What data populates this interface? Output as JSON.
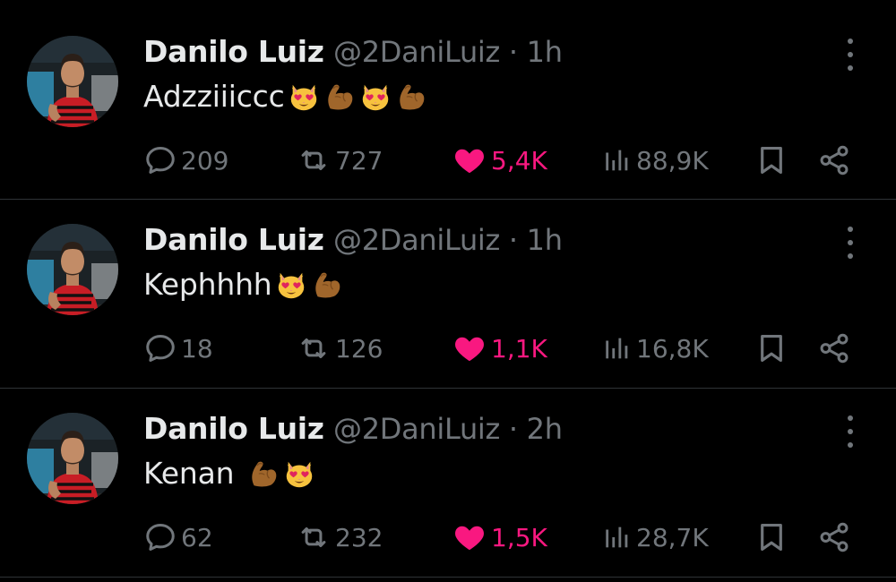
{
  "feed": {
    "tweets": [
      {
        "name": "Danilo Luiz",
        "handle": "@2DaniLuiz",
        "time": "· 1h",
        "text": "Adzziiiccc",
        "emojis": [
          "heart-eyes-cat-icon",
          "flexed-biceps-icon",
          "heart-eyes-cat-icon",
          "flexed-biceps-icon"
        ],
        "replies": "209",
        "reposts": "727",
        "likes": "5,4K",
        "views": "88,9K",
        "liked": true
      },
      {
        "name": "Danilo Luiz",
        "handle": "@2DaniLuiz",
        "time": "· 1h",
        "text": "Kephhhh",
        "emojis": [
          "heart-eyes-cat-icon",
          "flexed-biceps-icon"
        ],
        "replies": "18",
        "reposts": "126",
        "likes": "1,1K",
        "views": "16,8K",
        "liked": true
      },
      {
        "name": "Danilo Luiz",
        "handle": "@2DaniLuiz",
        "time": "· 2h",
        "text": "Kenan",
        "emojis": [
          "flexed-biceps-icon",
          "heart-eyes-cat-icon"
        ],
        "replies": "62",
        "reposts": "232",
        "likes": "1,5K",
        "views": "28,7K",
        "liked": true
      }
    ]
  },
  "colors": {
    "background": "#000000",
    "primary_text": "#e7e9ea",
    "secondary_text": "#71767b",
    "like_pink": "#f91880",
    "divider": "#2f3336"
  }
}
